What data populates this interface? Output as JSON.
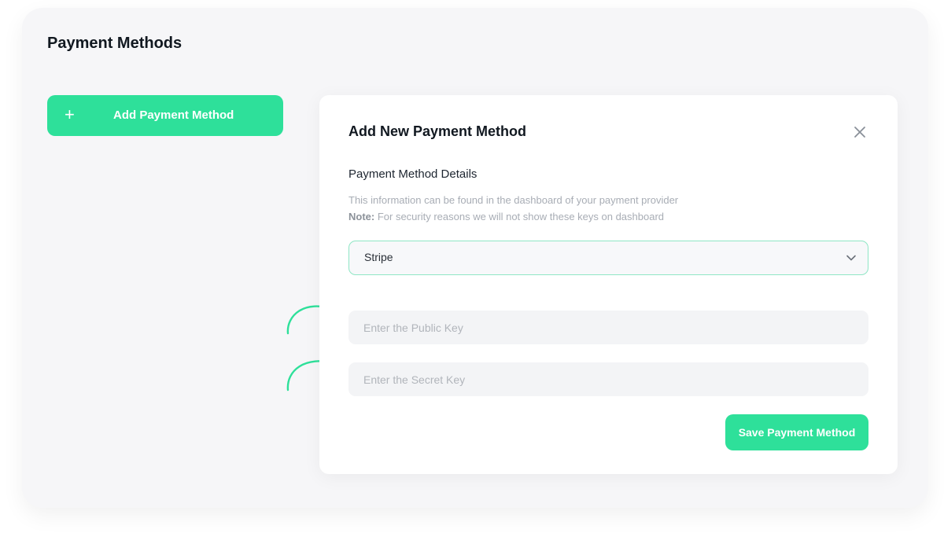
{
  "page": {
    "title": "Payment Methods",
    "add_button_icon": "+",
    "add_button_label": "Add Payment Method"
  },
  "modal": {
    "title": "Add New Payment Method",
    "close_icon": "close-icon",
    "section_title": "Payment Method Details",
    "help_line": "This information can be found in the dashboard of your payment provider",
    "note_label": "Note:",
    "note_text": " For security reasons we will not show these keys on dashboard",
    "provider_select": {
      "value": "Stripe",
      "icon": "chevron-down-icon"
    },
    "public_key": {
      "value": "",
      "placeholder": "Enter the Public Key"
    },
    "secret_key": {
      "value": "",
      "placeholder": "Enter the Secret Key"
    },
    "save_label": "Save Payment Method"
  },
  "colors": {
    "accent": "#2ee09a",
    "panel_bg": "#f6f6f8",
    "text_dark": "#111820",
    "muted": "#a8adb5"
  }
}
